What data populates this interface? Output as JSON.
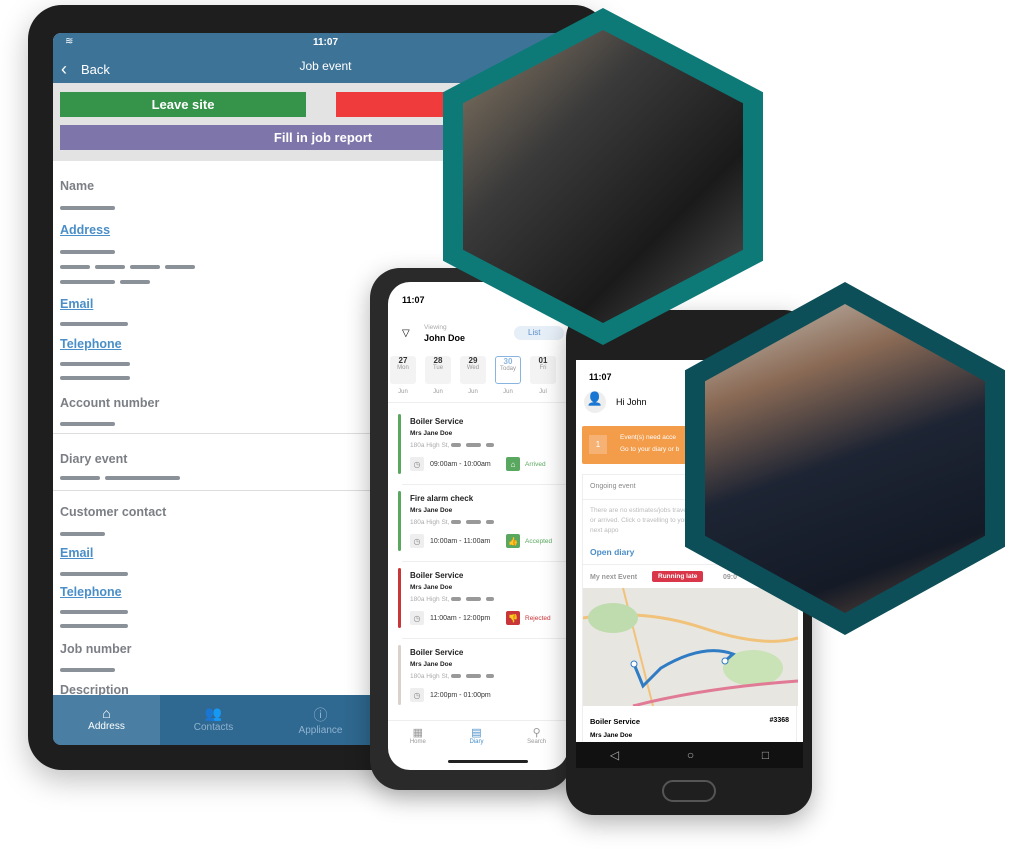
{
  "tablet": {
    "status_time": "11:07",
    "back_label": "Back",
    "title": "Job event",
    "buttons": {
      "leave_site": "Leave site",
      "fill_report": "Fill in job report"
    },
    "fields": {
      "name": "Name",
      "address": "Address",
      "email": "Email",
      "telephone": "Telephone",
      "account_number": "Account number",
      "diary_event": "Diary event",
      "customer_contact": "Customer contact",
      "email2": "Email",
      "telephone2": "Telephone",
      "job_number": "Job number",
      "description": "Description"
    },
    "nav": [
      {
        "label": "Address",
        "icon": "home-icon"
      },
      {
        "label": "Contacts",
        "icon": "contacts-icon"
      },
      {
        "label": "Appliance",
        "icon": "info-icon"
      }
    ],
    "colors": {
      "header": "#3e7398",
      "green": "#35934a",
      "red": "#ef3b3b",
      "purple": "#7e75aa"
    }
  },
  "phone1": {
    "status_time": "11:07",
    "viewing_label": "Viewing",
    "viewing_name": "John Doe",
    "list_button": "List",
    "days": [
      {
        "num": "27",
        "dow": "Mon",
        "mon": "Jun"
      },
      {
        "num": "28",
        "dow": "Tue",
        "mon": "Jun"
      },
      {
        "num": "29",
        "dow": "Wed",
        "mon": "Jun"
      },
      {
        "num": "30",
        "dow": "Today",
        "mon": "Jun"
      },
      {
        "num": "01",
        "dow": "Fri",
        "mon": "Jul"
      }
    ],
    "events": [
      {
        "title": "Boiler Service",
        "customer": "Mrs Jane Doe",
        "address": "180a High St,",
        "time": "09:00am - 10:00am",
        "status": "Arrived",
        "color": "#5aa85f"
      },
      {
        "title": "Fire alarm check",
        "customer": "Mrs Jane Doe",
        "address": "180a High St,",
        "time": "10:00am - 11:00am",
        "status": "Accepted",
        "color": "#5aa85f"
      },
      {
        "title": "Boiler Service",
        "customer": "Mrs Jane Doe",
        "address": "180a High St,",
        "time": "11:00am - 12:00pm",
        "status": "Rejected",
        "color": "#c9363a"
      },
      {
        "title": "Boiler Service",
        "customer": "Mrs Jane Doe",
        "address": "180a High St,",
        "time": "12:00pm - 01:00pm",
        "status": "",
        "color": "#d9d2cc"
      }
    ],
    "nav": [
      {
        "label": "Home"
      },
      {
        "label": "Diary"
      },
      {
        "label": "Search"
      }
    ]
  },
  "phone2": {
    "status_time": "11:07",
    "greeting": "Hi John",
    "alert_count": "1",
    "alert_line1": "Event(s) need acce",
    "alert_line2": "Go to your diary or b",
    "ongoing_title": "Ongoing event",
    "ongoing_text": "There are no estimates/jobs travelling or arrived. Click o travelling to your next appo",
    "open_diary": "Open diary",
    "next_event_label": "My next Event",
    "running_late": "Running late",
    "next_time": "09:0",
    "event_title": "Boiler Service",
    "event_number": "#3368",
    "event_customer": "Mrs Jane Doe",
    "colors": {
      "alert": "#f39c4a",
      "late": "#d9364a",
      "route": "#2f7bc4"
    }
  }
}
